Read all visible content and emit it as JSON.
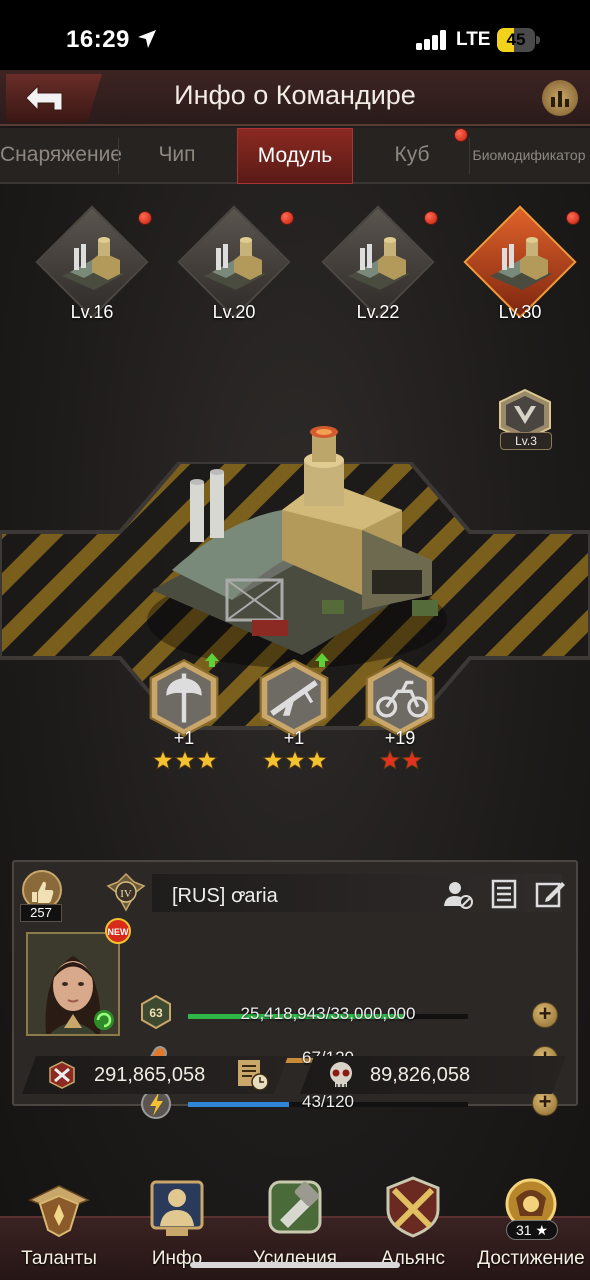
{
  "status_bar": {
    "time": "16:29",
    "network": "LTE",
    "battery": "45",
    "battery_level": 0.45,
    "battery_color": "#f2d21b"
  },
  "header": {
    "title": "Инфо о Командире",
    "back_icon": "back-arrow-icon",
    "stats_icon": "bar-chart-icon"
  },
  "tabs": [
    {
      "label": "Снаряжение",
      "active": false,
      "dot": false
    },
    {
      "label": "Чип",
      "active": false,
      "dot": false
    },
    {
      "label": "Модуль",
      "active": true,
      "dot": false
    },
    {
      "label": "Куб",
      "active": false,
      "dot": true
    },
    {
      "label": "Биомодификатор",
      "active": false,
      "dot": false
    }
  ],
  "modules": [
    {
      "level": "Lv.16",
      "selected": false,
      "dot": true
    },
    {
      "level": "Lv.20",
      "selected": false,
      "dot": true
    },
    {
      "level": "Lv.22",
      "selected": false,
      "dot": true
    },
    {
      "level": "Lv.30",
      "selected": true,
      "dot": true
    }
  ],
  "module_rank": {
    "level": "Lv.3",
    "icon": "rank-v-badge-icon"
  },
  "perks": [
    {
      "value": "+1",
      "icon": "axe-icon",
      "stars": 3,
      "star_color": "#f2c230",
      "upgrade": true
    },
    {
      "value": "+1",
      "icon": "rifle-icon",
      "stars": 3,
      "star_color": "#f2c230",
      "upgrade": true
    },
    {
      "value": "+19",
      "icon": "motorcycle-icon",
      "stars": 2,
      "star_color": "#e0321e",
      "upgrade": false
    }
  ],
  "commander": {
    "likes": "257",
    "name": "[RUS]  ꝍaria",
    "rank": "IV",
    "level": "63",
    "new_badge": "NEW",
    "exp": {
      "text": "25,418,943/33,000,000",
      "fraction": 0.77,
      "color": "#2fb84a"
    },
    "stamina": {
      "text": "67/120",
      "fraction": 0.56,
      "color": "#c98a3a"
    },
    "energy": {
      "text": "43/120",
      "fraction": 0.36,
      "color": "#2f86d8"
    },
    "power": "291,865,058",
    "kills": "89,826,058"
  },
  "nav": [
    {
      "label": "Таланты",
      "icon": "talents-icon"
    },
    {
      "label": "Инфо",
      "icon": "info-icon"
    },
    {
      "label": "Усиления",
      "icon": "boosts-icon"
    },
    {
      "label": "Альянс",
      "icon": "alliance-icon"
    },
    {
      "label": "Достижение",
      "icon": "achievement-icon",
      "count": "31 ★"
    }
  ]
}
